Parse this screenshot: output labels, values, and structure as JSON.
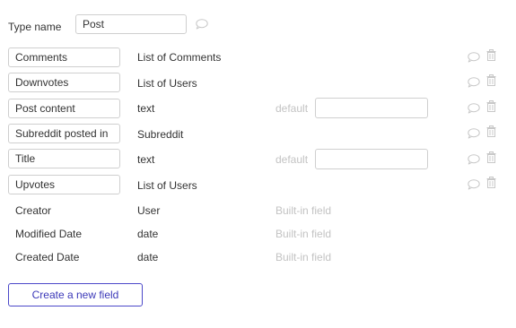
{
  "type_name": {
    "label": "Type name",
    "value": "Post"
  },
  "fields": [
    {
      "name": "Comments",
      "type": "List of Comments"
    },
    {
      "name": "Downvotes",
      "type": "List of Users"
    },
    {
      "name": "Post content",
      "type": "text",
      "default_label": "default",
      "default_value": ""
    },
    {
      "name": "Subreddit posted in",
      "type": "Subreddit"
    },
    {
      "name": "Title",
      "type": "text",
      "default_label": "default",
      "default_value": ""
    },
    {
      "name": "Upvotes",
      "type": "List of Users"
    }
  ],
  "builtin_fields": [
    {
      "name": "Creator",
      "type": "User",
      "note": "Built-in field"
    },
    {
      "name": "Modified Date",
      "type": "date",
      "note": "Built-in field"
    },
    {
      "name": "Created Date",
      "type": "date",
      "note": "Built-in field"
    }
  ],
  "create_button": "Create a new field",
  "icons": {
    "comment": "speech-bubble-icon",
    "delete": "trash-icon"
  },
  "colors": {
    "accent": "#4b48c9",
    "muted": "#c3c3c3",
    "icon": "#c8c8c8"
  }
}
